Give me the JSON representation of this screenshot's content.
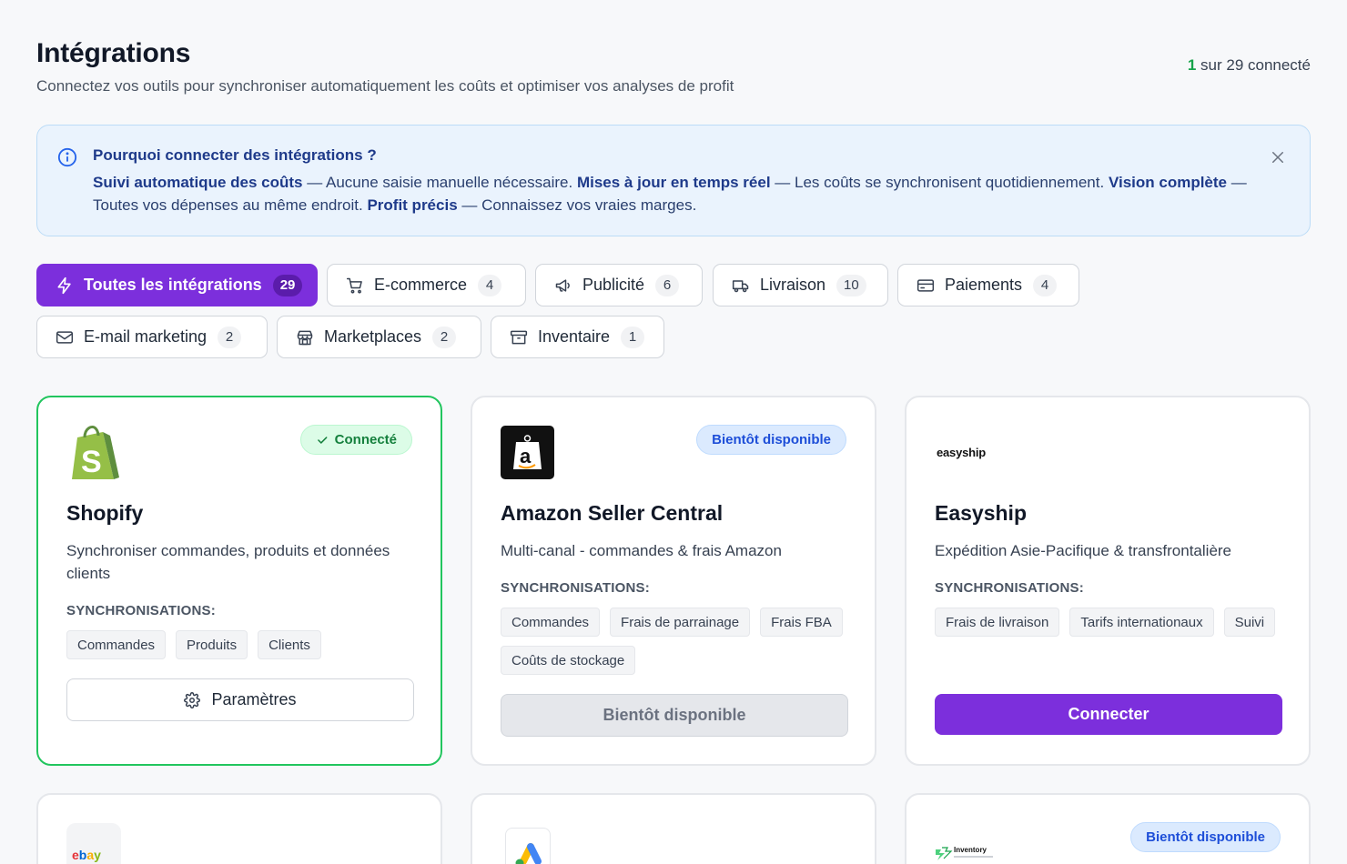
{
  "header": {
    "title": "Intégrations",
    "subtitle": "Connectez vos outils pour synchroniser automatiquement les coûts et optimiser vos analyses de profit",
    "connected_num": "1",
    "connected_rest": " sur 29 connecté"
  },
  "info": {
    "title": "Pourquoi connecter des intégrations ?",
    "b1": "Suivi automatique des coûts",
    "t1": " — Aucune saisie manuelle nécessaire. ",
    "b2": "Mises à jour en temps réel",
    "t2": " — Les coûts se synchronisent quotidiennement. ",
    "b3": "Vision complète",
    "t3": " — Toutes vos dépenses au même endroit. ",
    "b4": "Profit précis",
    "t4": " — Connaissez vos vraies marges."
  },
  "filters": [
    {
      "label": "Toutes les intégrations",
      "count": "29",
      "icon": "lightning-icon"
    },
    {
      "label": "E-commerce",
      "count": "4",
      "icon": "cart-icon"
    },
    {
      "label": "Publicité",
      "count": "6",
      "icon": "megaphone-icon"
    },
    {
      "label": "Livraison",
      "count": "10",
      "icon": "truck-icon"
    },
    {
      "label": "Paiements",
      "count": "4",
      "icon": "credit-card-icon"
    },
    {
      "label": "E-mail marketing",
      "count": "2",
      "icon": "mail-icon"
    },
    {
      "label": "Marketplaces",
      "count": "2",
      "icon": "store-icon"
    },
    {
      "label": "Inventaire",
      "count": "1",
      "icon": "archive-icon"
    }
  ],
  "sync_label": "SYNCHRONISATIONS:",
  "cards": [
    {
      "name": "Shopify",
      "badge": "Connecté",
      "desc": "Synchroniser commandes, produits et données clients",
      "tags": [
        "Commandes",
        "Produits",
        "Clients"
      ],
      "button": "Paramètres"
    },
    {
      "name": "Amazon Seller Central",
      "badge": "Bientôt disponible",
      "desc": "Multi-canal - commandes & frais Amazon",
      "tags": [
        "Commandes",
        "Frais de parrainage",
        "Frais FBA",
        "Coûts de stockage"
      ],
      "button": "Bientôt disponible"
    },
    {
      "name": "Easyship",
      "logo_text": "easyship",
      "desc": "Expédition Asie-Pacifique & transfrontalière",
      "tags": [
        "Frais de livraison",
        "Tarifs internationaux",
        "Suivi"
      ],
      "button": "Connecter"
    }
  ],
  "row2": {
    "ebay_logo": "ebay",
    "inventory_logo": "Inventory",
    "inventory_badge": "Bientôt disponible"
  },
  "colors": {
    "accent": "#7c2fdc",
    "connected": "#22c55e",
    "info_bg": "#eaf3fd"
  }
}
